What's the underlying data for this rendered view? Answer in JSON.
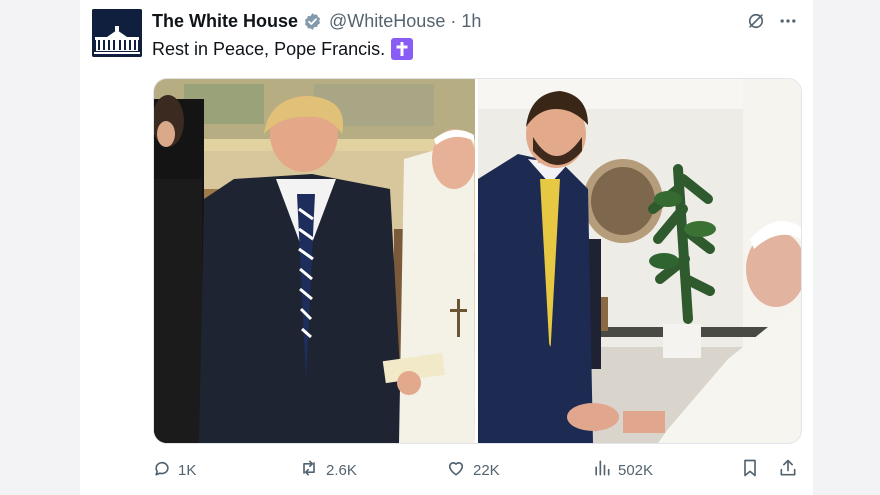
{
  "post": {
    "author_name": "The White House",
    "handle": "@WhiteHouse",
    "separator": "·",
    "time": "1h",
    "text": "Rest in Peace, Pope Francis.",
    "emoji": "latin-cross-icon"
  },
  "stats": {
    "replies": "1K",
    "reposts": "2.6K",
    "likes": "22K",
    "views": "502K"
  },
  "colors": {
    "verified_badge": "#829aab",
    "cross_emoji_bg": "#8a5cf6",
    "muted_text": "#536471"
  },
  "icons": [
    "grok-icon",
    "more-icon",
    "reply-icon",
    "repost-icon",
    "like-icon",
    "views-icon",
    "bookmark-icon",
    "share-icon"
  ]
}
